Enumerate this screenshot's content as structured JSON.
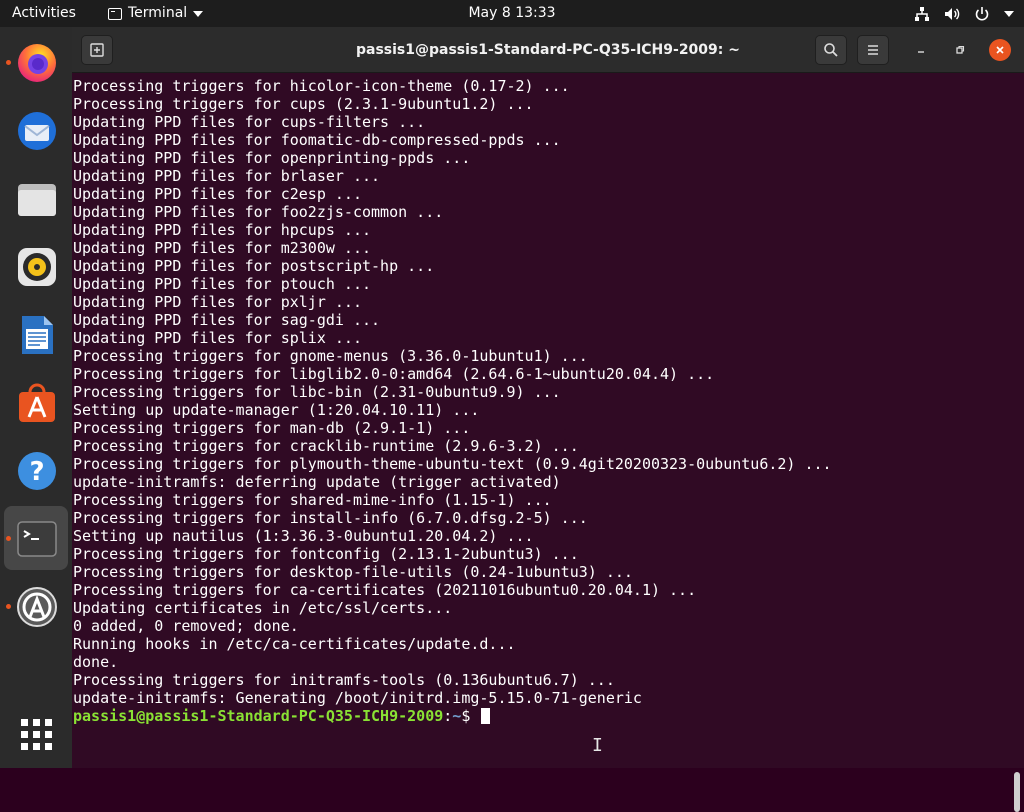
{
  "topbar": {
    "activities": "Activities",
    "app_name": "Terminal",
    "clock": "May 8  13:33",
    "status_icons": [
      "network-icon",
      "volume-icon",
      "power-icon",
      "chevron-down-icon"
    ]
  },
  "dock": {
    "items": [
      {
        "name": "Firefox",
        "icon": "firefox-icon",
        "running": true
      },
      {
        "name": "Thunderbird",
        "icon": "thunderbird-icon",
        "running": false
      },
      {
        "name": "Files",
        "icon": "files-icon",
        "running": false
      },
      {
        "name": "Rhythmbox",
        "icon": "rhythmbox-icon",
        "running": false
      },
      {
        "name": "LibreOffice Writer",
        "icon": "writer-icon",
        "running": false
      },
      {
        "name": "Ubuntu Software",
        "icon": "software-icon",
        "running": false
      },
      {
        "name": "Help",
        "icon": "help-icon",
        "running": false
      },
      {
        "name": "Terminal",
        "icon": "terminal-icon",
        "running": true
      },
      {
        "name": "Software Updater",
        "icon": "updater-icon",
        "running": true
      }
    ],
    "show_apps_icon": "apps-grid-icon"
  },
  "window": {
    "title": "passis1@passis1-Standard-PC-Q35-ICH9-2009: ~",
    "controls": [
      "new-tab-icon",
      "search-icon",
      "menu-icon",
      "minimize-icon",
      "maximize-icon",
      "close-icon"
    ]
  },
  "terminal": {
    "lines": [
      "Processing triggers for hicolor-icon-theme (0.17-2) ...",
      "Processing triggers for cups (2.3.1-9ubuntu1.2) ...",
      "Updating PPD files for cups-filters ...",
      "Updating PPD files for foomatic-db-compressed-ppds ...",
      "Updating PPD files for openprinting-ppds ...",
      "Updating PPD files for brlaser ...",
      "Updating PPD files for c2esp ...",
      "Updating PPD files for foo2zjs-common ...",
      "Updating PPD files for hpcups ...",
      "Updating PPD files for m2300w ...",
      "Updating PPD files for postscript-hp ...",
      "Updating PPD files for ptouch ...",
      "Updating PPD files for pxljr ...",
      "Updating PPD files for sag-gdi ...",
      "Updating PPD files for splix ...",
      "Processing triggers for gnome-menus (3.36.0-1ubuntu1) ...",
      "Processing triggers for libglib2.0-0:amd64 (2.64.6-1~ubuntu20.04.4) ...",
      "Processing triggers for libc-bin (2.31-0ubuntu9.9) ...",
      "Setting up update-manager (1:20.04.10.11) ...",
      "Processing triggers for man-db (2.9.1-1) ...",
      "Processing triggers for cracklib-runtime (2.9.6-3.2) ...",
      "Processing triggers for plymouth-theme-ubuntu-text (0.9.4git20200323-0ubuntu6.2) ...",
      "update-initramfs: deferring update (trigger activated)",
      "Processing triggers for shared-mime-info (1.15-1) ...",
      "Processing triggers for install-info (6.7.0.dfsg.2-5) ...",
      "Setting up nautilus (1:3.36.3-0ubuntu1.20.04.2) ...",
      "Processing triggers for fontconfig (2.13.1-2ubuntu3) ...",
      "Processing triggers for desktop-file-utils (0.24-1ubuntu3) ...",
      "Processing triggers for ca-certificates (20211016ubuntu0.20.04.1) ...",
      "Updating certificates in /etc/ssl/certs...",
      "0 added, 0 removed; done.",
      "Running hooks in /etc/ca-certificates/update.d...",
      "done.",
      "Processing triggers for initramfs-tools (0.136ubuntu6.7) ...",
      "update-initramfs: Generating /boot/initrd.img-5.15.0-71-generic"
    ],
    "prompt": {
      "user_host": "passis1@passis1-Standard-PC-Q35-ICH9-2009",
      "separator": ":",
      "path": "~",
      "symbol": "$ "
    }
  },
  "colors": {
    "terminal_bg": "#300a24",
    "accent": "#e95420",
    "prompt_user": "#8ae234",
    "prompt_path": "#729fcf"
  }
}
